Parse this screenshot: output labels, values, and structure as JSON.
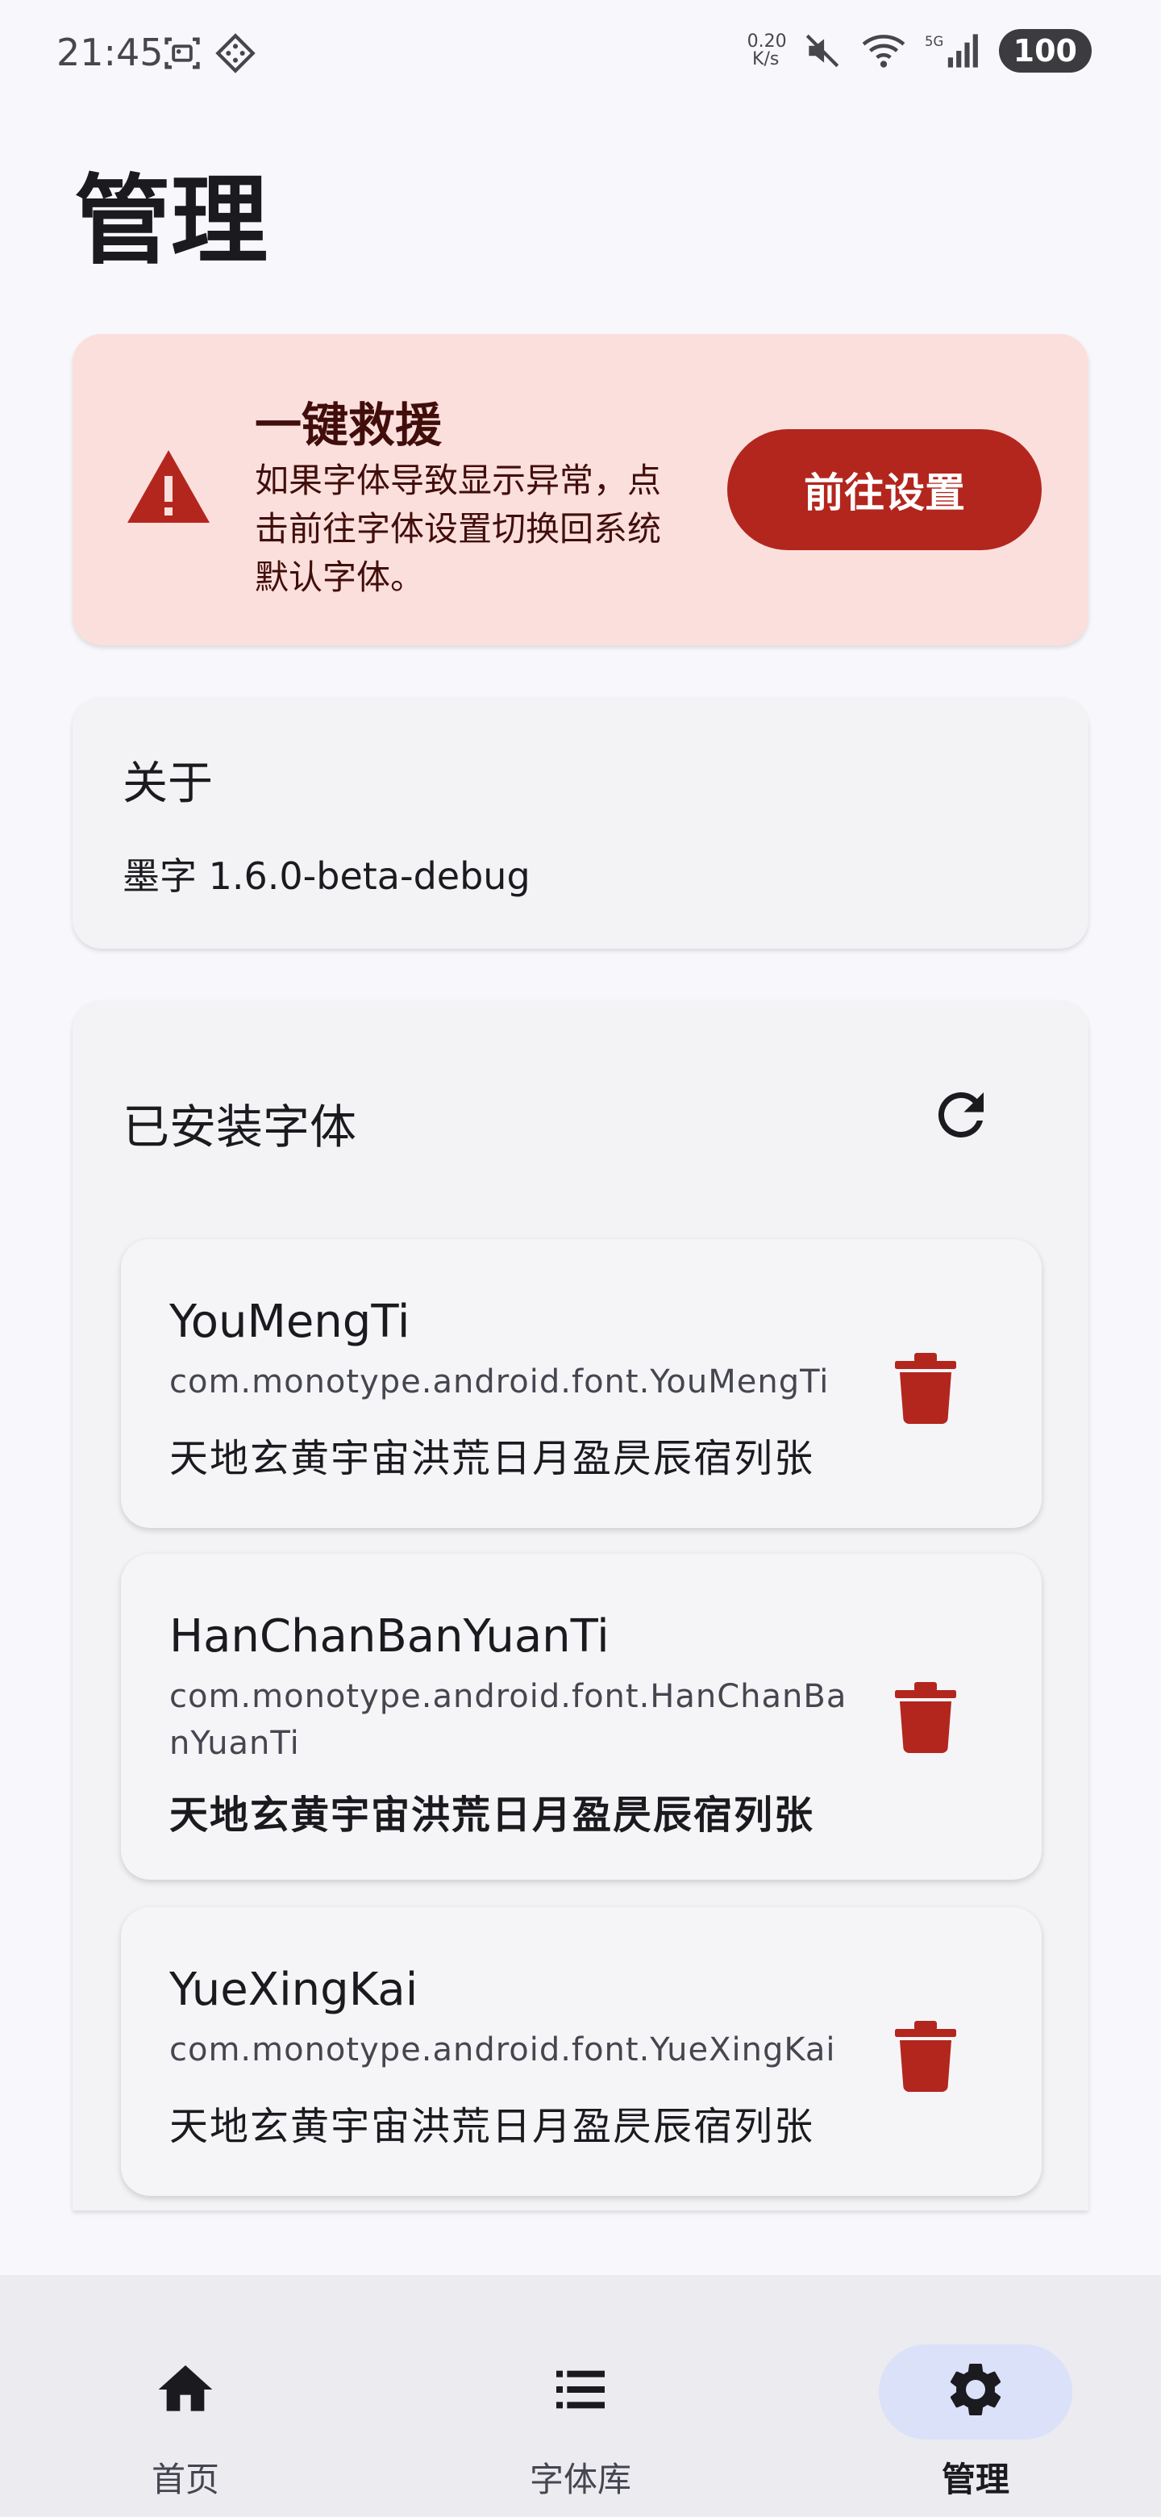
{
  "status_bar": {
    "time": "21:45",
    "net_speed_value": "0.20",
    "net_speed_unit": "K/s",
    "network_type": "5G",
    "battery": "100"
  },
  "page": {
    "title": "管理"
  },
  "rescue": {
    "title": "一键救援",
    "description": "如果字体导致显示异常，点击前往字体设置切换回系统默认字体。",
    "button_label": "前往设置",
    "accent_color": "#b3261e",
    "background_color": "#fbdfdc"
  },
  "about": {
    "title": "关于",
    "version": "墨字 1.6.0-beta-debug"
  },
  "installed": {
    "title": "已安装字体",
    "fonts": [
      {
        "name": "YouMengTi",
        "package": "com.monotype.android.font.YouMengTi",
        "sample": "天地玄黄宇宙洪荒日月盈昃辰宿列张"
      },
      {
        "name": "HanChanBanYuanTi",
        "package": "com.monotype.android.font.HanChanBanYuanTi",
        "sample": "天地玄黄宇宙洪荒日月盈昃辰宿列张"
      },
      {
        "name": "YueXingKai",
        "package": "com.monotype.android.font.YueXingKai",
        "sample": "天地玄黄宇宙洪荒日月盈昃辰宿列张"
      }
    ]
  },
  "bottom_nav": {
    "items": [
      {
        "label": "首页",
        "icon": "home-icon",
        "active": false
      },
      {
        "label": "字体库",
        "icon": "list-icon",
        "active": false
      },
      {
        "label": "管理",
        "icon": "gear-icon",
        "active": true
      }
    ]
  }
}
